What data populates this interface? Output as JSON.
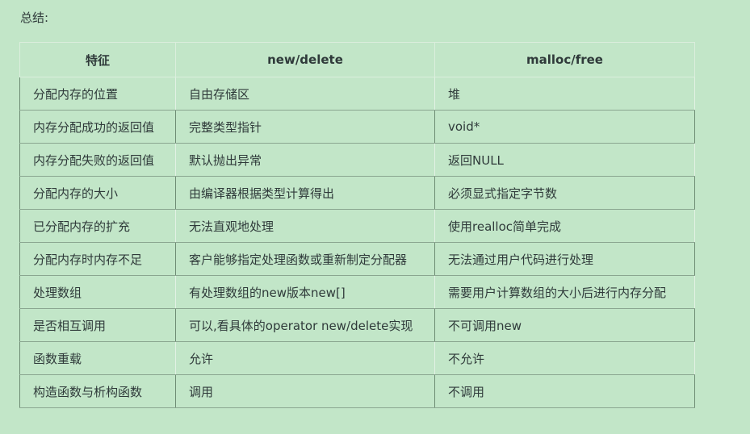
{
  "summary_label": "总结:",
  "table": {
    "headers": [
      "特征",
      "new/delete",
      "malloc/free"
    ],
    "rows": [
      [
        "分配内存的位置",
        "自由存储区",
        "堆"
      ],
      [
        "内存分配成功的返回值",
        "完整类型指针",
        "void*"
      ],
      [
        "内存分配失败的返回值",
        "默认抛出异常",
        "返回NULL"
      ],
      [
        "分配内存的大小",
        "由编译器根据类型计算得出",
        "必须显式指定字节数"
      ],
      [
        "已分配内存的扩充",
        "无法直观地处理",
        "使用realloc简单完成"
      ],
      [
        "分配内存时内存不足",
        "客户能够指定处理函数或重新制定分配器",
        "无法通过用户代码进行处理"
      ],
      [
        "处理数组",
        "有处理数组的new版本new[]",
        "需要用户计算数组的大小后进行内存分配"
      ],
      [
        "是否相互调用",
        "可以,看具体的operator new/delete实现",
        "不可调用new"
      ],
      [
        "函数重载",
        "允许",
        "不允许"
      ],
      [
        "构造函数与析构函数",
        "调用",
        "不调用"
      ]
    ]
  }
}
